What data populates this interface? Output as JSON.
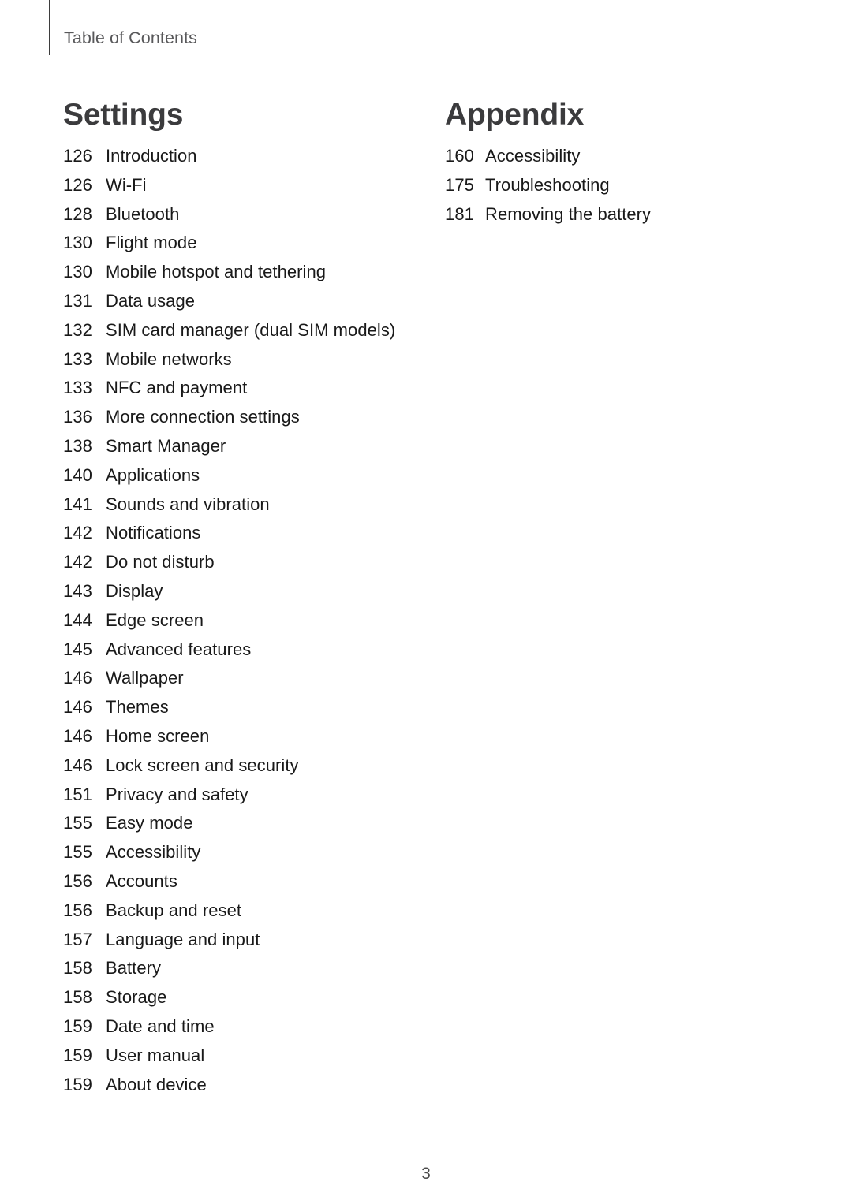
{
  "header": {
    "title": "Table of Contents"
  },
  "columns": [
    {
      "heading": "Settings",
      "entries": [
        {
          "page": "126",
          "label": "Introduction"
        },
        {
          "page": "126",
          "label": "Wi-Fi"
        },
        {
          "page": "128",
          "label": "Bluetooth"
        },
        {
          "page": "130",
          "label": "Flight mode"
        },
        {
          "page": "130",
          "label": "Mobile hotspot and tethering"
        },
        {
          "page": "131",
          "label": "Data usage"
        },
        {
          "page": "132",
          "label": "SIM card manager (dual SIM models)"
        },
        {
          "page": "133",
          "label": "Mobile networks"
        },
        {
          "page": "133",
          "label": "NFC and payment"
        },
        {
          "page": "136",
          "label": "More connection settings"
        },
        {
          "page": "138",
          "label": "Smart Manager"
        },
        {
          "page": "140",
          "label": "Applications"
        },
        {
          "page": "141",
          "label": "Sounds and vibration"
        },
        {
          "page": "142",
          "label": "Notifications"
        },
        {
          "page": "142",
          "label": "Do not disturb"
        },
        {
          "page": "143",
          "label": "Display"
        },
        {
          "page": "144",
          "label": "Edge screen"
        },
        {
          "page": "145",
          "label": "Advanced features"
        },
        {
          "page": "146",
          "label": "Wallpaper"
        },
        {
          "page": "146",
          "label": "Themes"
        },
        {
          "page": "146",
          "label": "Home screen"
        },
        {
          "page": "146",
          "label": "Lock screen and security"
        },
        {
          "page": "151",
          "label": "Privacy and safety"
        },
        {
          "page": "155",
          "label": "Easy mode"
        },
        {
          "page": "155",
          "label": "Accessibility"
        },
        {
          "page": "156",
          "label": "Accounts"
        },
        {
          "page": "156",
          "label": "Backup and reset"
        },
        {
          "page": "157",
          "label": "Language and input"
        },
        {
          "page": "158",
          "label": "Battery"
        },
        {
          "page": "158",
          "label": "Storage"
        },
        {
          "page": "159",
          "label": "Date and time"
        },
        {
          "page": "159",
          "label": "User manual"
        },
        {
          "page": "159",
          "label": "About device"
        }
      ]
    },
    {
      "heading": "Appendix",
      "entries": [
        {
          "page": "160",
          "label": "Accessibility"
        },
        {
          "page": "175",
          "label": "Troubleshooting"
        },
        {
          "page": "181",
          "label": "Removing the battery"
        }
      ]
    }
  ],
  "footer": {
    "page_number": "3"
  },
  "colors": {
    "body_text": "#191919",
    "heading_text": "#3b3b3d",
    "header_text": "#58585a",
    "rule": "#3d3d3d",
    "background": "#ffffff"
  }
}
